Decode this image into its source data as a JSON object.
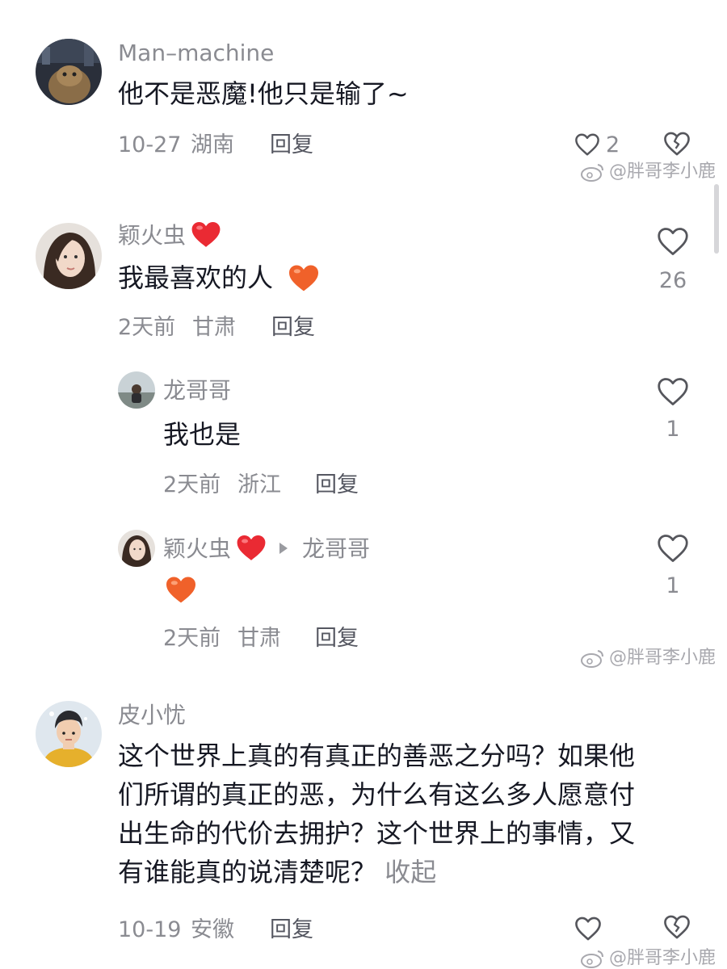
{
  "comments": [
    {
      "user": "Man–machine",
      "text": "他不是恶魔!他只是输了~",
      "date": "10-27",
      "location": "湖南",
      "reply_label": "回复",
      "likes": "2"
    },
    {
      "user": "颖火虫",
      "text": "我最喜欢的人",
      "date": "2天前",
      "location": "甘肃",
      "reply_label": "回复",
      "likes": "26",
      "replies": [
        {
          "user": "龙哥哥",
          "text": "我也是",
          "date": "2天前",
          "location": "浙江",
          "reply_label": "回复",
          "likes": "1"
        },
        {
          "user": "颖火虫",
          "reply_to": "龙哥哥",
          "text": "",
          "date": "2天前",
          "location": "甘肃",
          "reply_label": "回复",
          "likes": "1"
        }
      ]
    },
    {
      "user": "皮小忧",
      "text_lines": [
        "这个世界上真的有真正的善恶之分吗？如果他",
        "们所谓的真正的恶，为什么有这么多人愿意付",
        "出生命的代价去拥护？这个世界上的事情，又",
        "有谁能真的说清楚呢？"
      ],
      "collapse_label": "收起",
      "date": "10-19",
      "location": "安徽",
      "reply_label": "回复"
    }
  ],
  "watermark": "@胖哥李小鹿",
  "colors": {
    "heart_red": "#ea2a33",
    "heart_orange": "#f0612a",
    "muted_text": "#8a8b91",
    "main_text": "#161823"
  },
  "icons": {
    "like": "heart-outline-icon",
    "dislike": "broken-heart-icon",
    "reply_arrow": "triangle-right-icon",
    "watermark_logo": "weibo-icon"
  }
}
